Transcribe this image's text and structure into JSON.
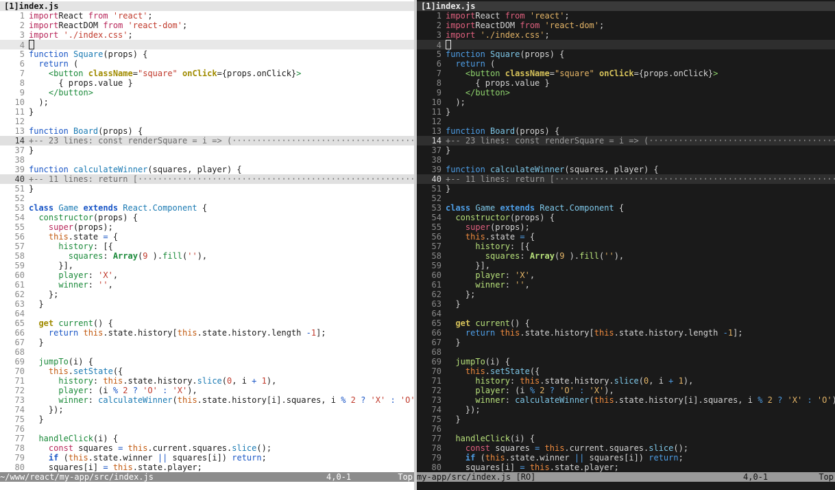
{
  "tab_label": "[1]index.js",
  "status": {
    "left_file": "~/www/react/my-app/src/index.js",
    "right_file": "my-app/src/index.js [RO]",
    "position": "4,0-1",
    "scroll": "Top"
  },
  "lines": [
    {
      "n": "1",
      "t": [
        [
          "kw",
          "import"
        ],
        [
          "",
          "React "
        ],
        [
          "kw",
          "from"
        ],
        [
          "",
          ""
        ],
        [
          "str",
          " 'react'"
        ],
        [
          "",
          ";"
        ]
      ]
    },
    {
      "n": "2",
      "t": [
        [
          "kw",
          "import"
        ],
        [
          "",
          "ReactDOM "
        ],
        [
          "kw",
          "from"
        ],
        [
          "str",
          " 'react-dom'"
        ],
        [
          "",
          ";"
        ]
      ]
    },
    {
      "n": "3",
      "t": [
        [
          "kw",
          "import"
        ],
        [
          "str",
          " './index.css'"
        ],
        [
          "",
          ";"
        ]
      ]
    },
    {
      "n": "4",
      "cursor": true,
      "t": []
    },
    {
      "n": "5",
      "t": [
        [
          "kw2",
          "function"
        ],
        [
          "fn",
          " Square"
        ],
        [
          "",
          "(props) {"
        ]
      ]
    },
    {
      "n": "6",
      "t": [
        [
          "",
          ""
        ],
        [
          "kw2",
          "  return"
        ],
        [
          "",
          " ("
        ]
      ]
    },
    {
      "n": "7",
      "t": [
        [
          "tag",
          "    <button"
        ],
        [
          "attr",
          " className"
        ],
        [
          "",
          "="
        ],
        [
          "str",
          "\"square\""
        ],
        [
          "attr",
          " onClick"
        ],
        [
          "",
          "={props.onClick}"
        ],
        [
          "tag",
          ">"
        ]
      ]
    },
    {
      "n": "8",
      "t": [
        [
          "",
          "      { props.value }"
        ]
      ]
    },
    {
      "n": "9",
      "t": [
        [
          "tag",
          "    </button>"
        ]
      ]
    },
    {
      "n": "10",
      "t": [
        [
          "",
          "  );"
        ]
      ]
    },
    {
      "n": "11",
      "t": [
        [
          "",
          "}"
        ]
      ]
    },
    {
      "n": "12",
      "t": []
    },
    {
      "n": "13",
      "t": [
        [
          "kw2",
          "function"
        ],
        [
          "fn",
          " Board"
        ],
        [
          "",
          "(props) {"
        ]
      ]
    },
    {
      "n": "14",
      "fold": true,
      "t": [
        [
          "",
          "+-- 23 lines: const renderSquare = i => (·······································································"
        ]
      ]
    },
    {
      "n": "37",
      "t": [
        [
          "",
          "}"
        ]
      ]
    },
    {
      "n": "38",
      "t": []
    },
    {
      "n": "39",
      "t": [
        [
          "kw2",
          "function"
        ],
        [
          "fn",
          " calculateWinner"
        ],
        [
          "",
          "(squares, player) {"
        ]
      ]
    },
    {
      "n": "40",
      "fold": true,
      "t": [
        [
          "",
          "+-- 11 lines: return [···································································································"
        ]
      ]
    },
    {
      "n": "51",
      "t": [
        [
          "",
          "}"
        ]
      ]
    },
    {
      "n": "52",
      "t": []
    },
    {
      "n": "53",
      "t": [
        [
          "kwb",
          "class"
        ],
        [
          "cls",
          " Game"
        ],
        [
          "kwb",
          " extends"
        ],
        [
          "cls",
          " React"
        ],
        [
          "",
          ""
        ],
        [
          "cls",
          ".Component"
        ],
        [
          "",
          " {"
        ]
      ]
    },
    {
      "n": "54",
      "t": [
        [
          "mth",
          "  constructor"
        ],
        [
          "",
          "(props) {"
        ]
      ]
    },
    {
      "n": "55",
      "t": [
        [
          "kw",
          "    super"
        ],
        [
          "",
          "(props);"
        ]
      ]
    },
    {
      "n": "56",
      "t": [
        [
          "this",
          "    this"
        ],
        [
          "",
          ".state "
        ],
        [
          "op",
          "="
        ],
        [
          "",
          " {"
        ]
      ]
    },
    {
      "n": "57",
      "t": [
        [
          "prop",
          "      history"
        ],
        [
          "",
          ": [{"
        ]
      ]
    },
    {
      "n": "58",
      "t": [
        [
          "prop",
          "        squares"
        ],
        [
          "",
          ": "
        ],
        [
          "bold",
          "Array"
        ],
        [
          "",
          "("
        ],
        [
          "num",
          "9"
        ],
        [
          "",
          " )."
        ],
        [
          "mth",
          "fill"
        ],
        [
          "",
          "("
        ],
        [
          "str",
          "''"
        ],
        [
          "",
          "),"
        ]
      ]
    },
    {
      "n": "59",
      "t": [
        [
          "",
          "      }],"
        ]
      ]
    },
    {
      "n": "60",
      "t": [
        [
          "prop",
          "      player"
        ],
        [
          "",
          ": "
        ],
        [
          "str",
          "'X'"
        ],
        [
          "",
          ","
        ]
      ]
    },
    {
      "n": "61",
      "t": [
        [
          "prop",
          "      winner"
        ],
        [
          "",
          ": "
        ],
        [
          "str",
          "''"
        ],
        [
          "",
          ","
        ]
      ]
    },
    {
      "n": "62",
      "t": [
        [
          "",
          "    };"
        ]
      ]
    },
    {
      "n": "63",
      "t": [
        [
          "",
          "  }"
        ]
      ]
    },
    {
      "n": "64",
      "t": []
    },
    {
      "n": "65",
      "t": [
        [
          "attr",
          "  get"
        ],
        [
          "mth",
          " current"
        ],
        [
          "",
          "() {"
        ]
      ]
    },
    {
      "n": "66",
      "t": [
        [
          "kw2",
          "    return"
        ],
        [
          "this",
          " this"
        ],
        [
          "",
          ".state.history["
        ],
        [
          "this",
          "this"
        ],
        [
          "",
          ".state.history.length "
        ],
        [
          "op",
          "-"
        ],
        [
          "num",
          "1"
        ],
        [
          "",
          "];"
        ]
      ]
    },
    {
      "n": "67",
      "t": [
        [
          "",
          "  }"
        ]
      ]
    },
    {
      "n": "68",
      "t": []
    },
    {
      "n": "69",
      "t": [
        [
          "mth",
          "  jumpTo"
        ],
        [
          "",
          "(i) {"
        ]
      ]
    },
    {
      "n": "70",
      "t": [
        [
          "this",
          "    this"
        ],
        [
          "",
          "."
        ],
        [
          "fn",
          "setState"
        ],
        [
          "",
          "({"
        ]
      ]
    },
    {
      "n": "71",
      "t": [
        [
          "prop",
          "      history"
        ],
        [
          "",
          ": "
        ],
        [
          "this",
          "this"
        ],
        [
          "",
          ".state.history."
        ],
        [
          "fn",
          "slice"
        ],
        [
          "",
          "("
        ],
        [
          "num",
          "0"
        ],
        [
          "",
          ", i "
        ],
        [
          "op",
          "+"
        ],
        [
          "num",
          " 1"
        ],
        [
          "",
          "),"
        ]
      ]
    },
    {
      "n": "72",
      "t": [
        [
          "prop",
          "      player"
        ],
        [
          "",
          ": (i "
        ],
        [
          "op",
          "%"
        ],
        [
          "num",
          " 2"
        ],
        [
          "op",
          " ?"
        ],
        [
          "str",
          " 'O'"
        ],
        [
          "op",
          " :"
        ],
        [
          "str",
          " 'X'"
        ],
        [
          "",
          "),"
        ]
      ]
    },
    {
      "n": "73",
      "t": [
        [
          "prop",
          "      winner"
        ],
        [
          "",
          ": "
        ],
        [
          "fn",
          "calculateWinner"
        ],
        [
          "",
          "("
        ],
        [
          "this",
          "this"
        ],
        [
          "",
          ".state.history[i].squares, i "
        ],
        [
          "op",
          "%"
        ],
        [
          "num",
          " 2"
        ],
        [
          "op",
          " ?"
        ],
        [
          "str",
          " 'X'"
        ],
        [
          "op",
          " :"
        ],
        [
          "str",
          " 'O'"
        ],
        [
          "",
          "),"
        ]
      ]
    },
    {
      "n": "74",
      "t": [
        [
          "",
          "    });"
        ]
      ]
    },
    {
      "n": "75",
      "t": [
        [
          "",
          "  }"
        ]
      ]
    },
    {
      "n": "76",
      "t": []
    },
    {
      "n": "77",
      "t": [
        [
          "mth",
          "  handleClick"
        ],
        [
          "",
          "(i) {"
        ]
      ]
    },
    {
      "n": "78",
      "t": [
        [
          "kw",
          "    const"
        ],
        [
          "",
          " squares "
        ],
        [
          "op",
          "="
        ],
        [
          "this",
          " this"
        ],
        [
          "",
          ".current.squares."
        ],
        [
          "fn",
          "slice"
        ],
        [
          "",
          "();"
        ]
      ]
    },
    {
      "n": "79",
      "t": [
        [
          "kwb",
          "    if"
        ],
        [
          "",
          " ("
        ],
        [
          "this",
          "this"
        ],
        [
          "",
          ".state.winner "
        ],
        [
          "op",
          "||"
        ],
        [
          "",
          " squares[i]) "
        ],
        [
          "kw2",
          "return"
        ],
        [
          "",
          ";"
        ]
      ]
    },
    {
      "n": "80",
      "t": [
        [
          "",
          "    squares[i] "
        ],
        [
          "op",
          "="
        ],
        [
          "this",
          " this"
        ],
        [
          "",
          ".state.player;"
        ]
      ]
    }
  ]
}
